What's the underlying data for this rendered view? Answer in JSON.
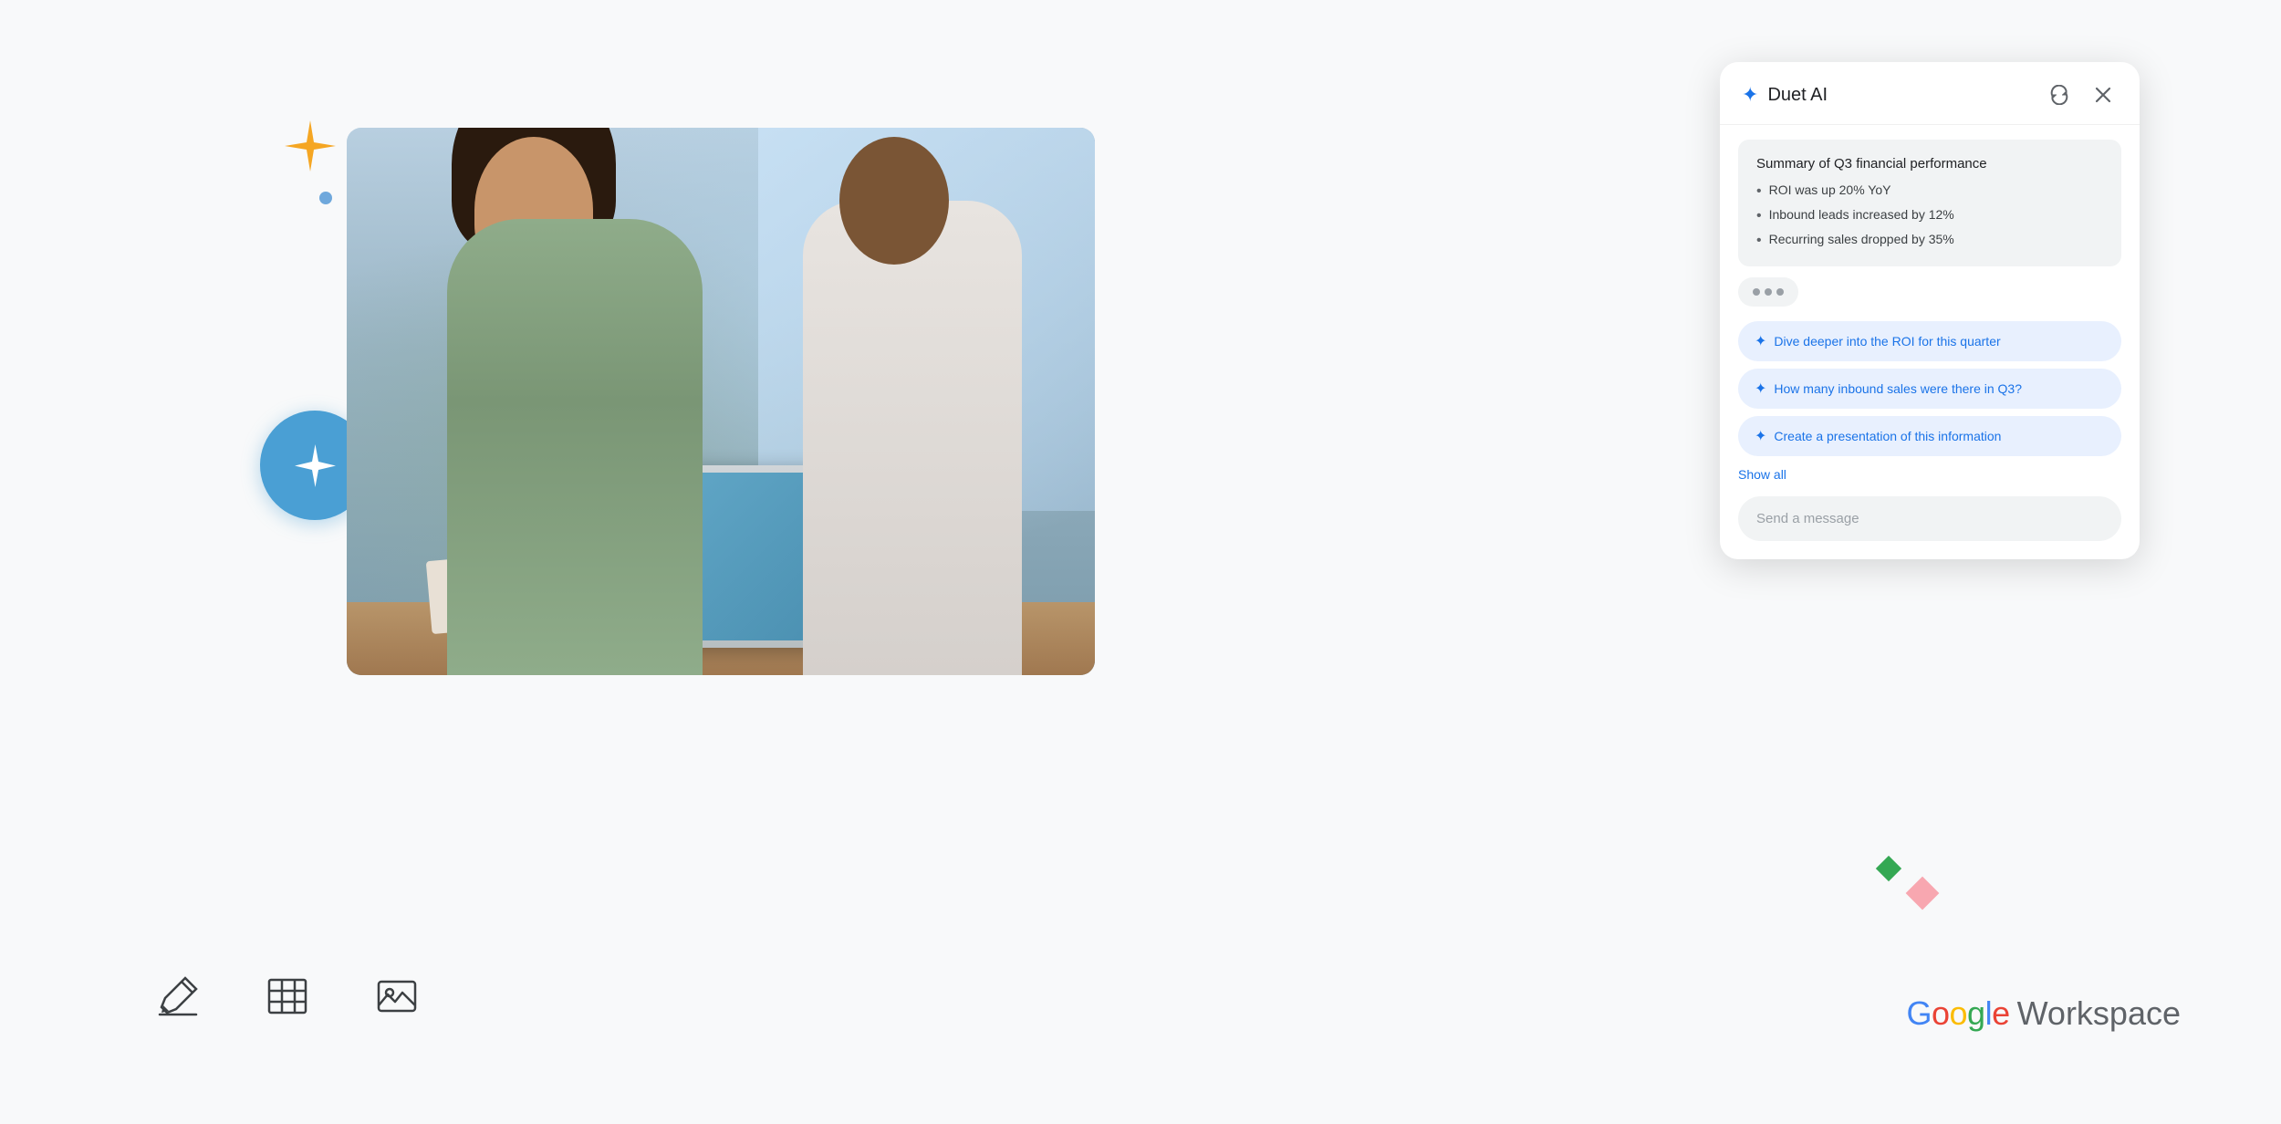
{
  "header": {
    "title": "Duet AI",
    "refresh_icon": "↺",
    "close_icon": "✕"
  },
  "summary": {
    "title": "Summary of Q3 financial performance",
    "items": [
      "ROI was up 20% YoY",
      "Inbound leads increased by 12%",
      "Recurring sales dropped by 35%"
    ]
  },
  "suggestions": [
    {
      "label": "Dive deeper into the ROI for this quarter"
    },
    {
      "label": "How many inbound sales were there in Q3?"
    },
    {
      "label": "Create a presentation of this information"
    }
  ],
  "show_all_label": "Show all",
  "input_placeholder": "Send a message",
  "branding": {
    "google_g": "G",
    "google_text_blue": "G",
    "google_text_red": "o",
    "google_text_yellow": "o",
    "google_text_green": "g",
    "google_text_blue2": "l",
    "google_text_red2": "e",
    "workspace_label": "Workspace"
  },
  "bottom_icons": {
    "edit_icon": "✏",
    "table_icon": "⊞",
    "image_icon": "⬚"
  },
  "decorations": {
    "sparkle_color": "#f5a623",
    "circle_color": "#4a9fd4",
    "dot_pink": "#f4a4a4",
    "dot_blue": "#6fa8dc"
  }
}
